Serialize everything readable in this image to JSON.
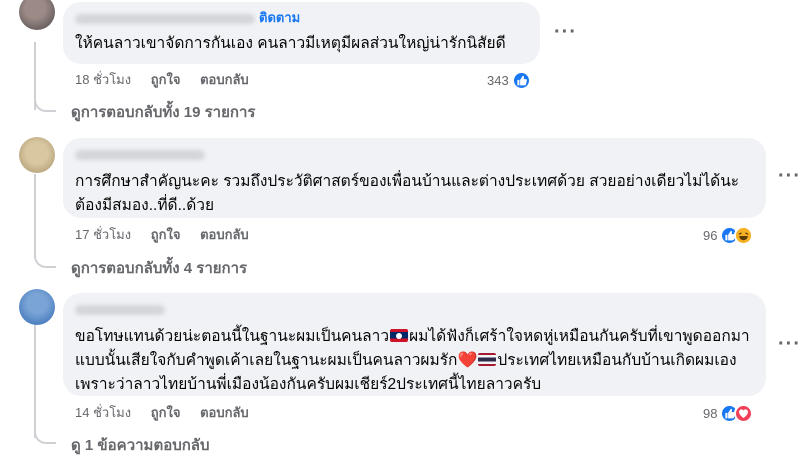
{
  "comments": [
    {
      "author": "",
      "follow_label": "ติดตาม",
      "text": "ให้คนลาวเขาจัดการกันเอง คนลาวมีเหตุมีผลส่วนใหญ่น่ารักนิสัยดี",
      "time": "18 ชั่วโมง",
      "like_label": "ถูกใจ",
      "reply_label": "ตอบกลับ",
      "reaction_count": "343",
      "reactions": [
        "like-icon"
      ],
      "view_replies": "ดูการตอบกลับทั้ง 19 รายการ"
    },
    {
      "author": "",
      "text": "การศึกษาสำคัญนะคะ รวมถึงประวัติศาสตร์ของเพื่อนบ้านและต่างประเทศด้วย สวยอย่างเดียวไม่ได้นะ ต้องมีสมอง..ที่ดี..ด้วย",
      "time": "17 ชั่วโมง",
      "like_label": "ถูกใจ",
      "reply_label": "ตอบกลับ",
      "reaction_count": "96",
      "reactions": [
        "like-icon",
        "haha-icon"
      ],
      "view_replies": "ดูการตอบกลับทั้ง 4 รายการ"
    },
    {
      "author": "",
      "text_parts": {
        "p1": "ขอโทษแทนด้วยน่ะตอนนี้ในฐานะผมเป็นคนลาว",
        "p2": "ผมได้ฟังก็เศร้าใจหดหู่เหมือนกันครับที่เขาพูดออกมาแบบนั้นเสียใจกับคำพูดเค้าเลยในฐานะผมเป็นคนลาวผมรัก",
        "p3": "ประเทศไทยเหมือนกับบ้านเกิดผมเองเพราะว่าลาวไทยบ้านพี่เมืองน้องกันครับผมเชียร์2ประเทศนี้ไทยลาวครับ"
      },
      "time": "14 ชั่วโมง",
      "like_label": "ถูกใจ",
      "reply_label": "ตอบกลับ",
      "reaction_count": "98",
      "reactions": [
        "like-icon",
        "love-icon"
      ],
      "view_replies": "ดู 1 ข้อความตอบกลับ"
    }
  ],
  "more_label": "···",
  "colors": {
    "accent": "#1877f2",
    "bubble": "#f0f2f5",
    "muted": "#65676b",
    "thread": "#ced0d4"
  }
}
